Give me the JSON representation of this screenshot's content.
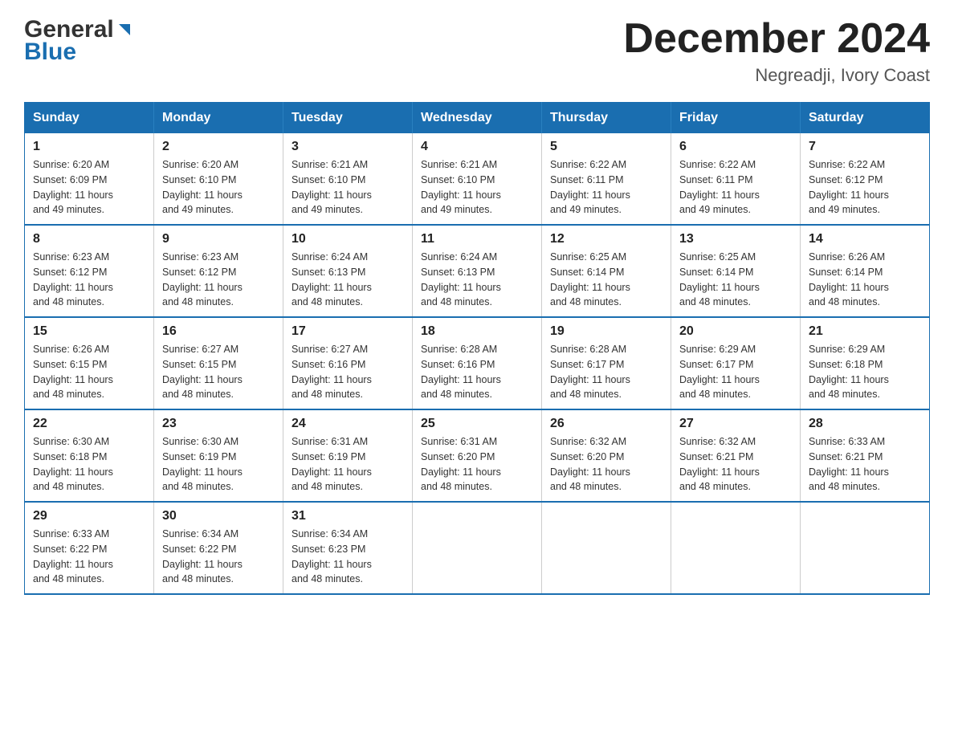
{
  "header": {
    "logo_general": "General",
    "logo_blue": "Blue",
    "month_title": "December 2024",
    "location": "Negreadji, Ivory Coast"
  },
  "days_of_week": [
    "Sunday",
    "Monday",
    "Tuesday",
    "Wednesday",
    "Thursday",
    "Friday",
    "Saturday"
  ],
  "weeks": [
    [
      {
        "day": "1",
        "sunrise": "6:20 AM",
        "sunset": "6:09 PM",
        "daylight": "11 hours and 49 minutes."
      },
      {
        "day": "2",
        "sunrise": "6:20 AM",
        "sunset": "6:10 PM",
        "daylight": "11 hours and 49 minutes."
      },
      {
        "day": "3",
        "sunrise": "6:21 AM",
        "sunset": "6:10 PM",
        "daylight": "11 hours and 49 minutes."
      },
      {
        "day": "4",
        "sunrise": "6:21 AM",
        "sunset": "6:10 PM",
        "daylight": "11 hours and 49 minutes."
      },
      {
        "day": "5",
        "sunrise": "6:22 AM",
        "sunset": "6:11 PM",
        "daylight": "11 hours and 49 minutes."
      },
      {
        "day": "6",
        "sunrise": "6:22 AM",
        "sunset": "6:11 PM",
        "daylight": "11 hours and 49 minutes."
      },
      {
        "day": "7",
        "sunrise": "6:22 AM",
        "sunset": "6:12 PM",
        "daylight": "11 hours and 49 minutes."
      }
    ],
    [
      {
        "day": "8",
        "sunrise": "6:23 AM",
        "sunset": "6:12 PM",
        "daylight": "11 hours and 48 minutes."
      },
      {
        "day": "9",
        "sunrise": "6:23 AM",
        "sunset": "6:12 PM",
        "daylight": "11 hours and 48 minutes."
      },
      {
        "day": "10",
        "sunrise": "6:24 AM",
        "sunset": "6:13 PM",
        "daylight": "11 hours and 48 minutes."
      },
      {
        "day": "11",
        "sunrise": "6:24 AM",
        "sunset": "6:13 PM",
        "daylight": "11 hours and 48 minutes."
      },
      {
        "day": "12",
        "sunrise": "6:25 AM",
        "sunset": "6:14 PM",
        "daylight": "11 hours and 48 minutes."
      },
      {
        "day": "13",
        "sunrise": "6:25 AM",
        "sunset": "6:14 PM",
        "daylight": "11 hours and 48 minutes."
      },
      {
        "day": "14",
        "sunrise": "6:26 AM",
        "sunset": "6:14 PM",
        "daylight": "11 hours and 48 minutes."
      }
    ],
    [
      {
        "day": "15",
        "sunrise": "6:26 AM",
        "sunset": "6:15 PM",
        "daylight": "11 hours and 48 minutes."
      },
      {
        "day": "16",
        "sunrise": "6:27 AM",
        "sunset": "6:15 PM",
        "daylight": "11 hours and 48 minutes."
      },
      {
        "day": "17",
        "sunrise": "6:27 AM",
        "sunset": "6:16 PM",
        "daylight": "11 hours and 48 minutes."
      },
      {
        "day": "18",
        "sunrise": "6:28 AM",
        "sunset": "6:16 PM",
        "daylight": "11 hours and 48 minutes."
      },
      {
        "day": "19",
        "sunrise": "6:28 AM",
        "sunset": "6:17 PM",
        "daylight": "11 hours and 48 minutes."
      },
      {
        "day": "20",
        "sunrise": "6:29 AM",
        "sunset": "6:17 PM",
        "daylight": "11 hours and 48 minutes."
      },
      {
        "day": "21",
        "sunrise": "6:29 AM",
        "sunset": "6:18 PM",
        "daylight": "11 hours and 48 minutes."
      }
    ],
    [
      {
        "day": "22",
        "sunrise": "6:30 AM",
        "sunset": "6:18 PM",
        "daylight": "11 hours and 48 minutes."
      },
      {
        "day": "23",
        "sunrise": "6:30 AM",
        "sunset": "6:19 PM",
        "daylight": "11 hours and 48 minutes."
      },
      {
        "day": "24",
        "sunrise": "6:31 AM",
        "sunset": "6:19 PM",
        "daylight": "11 hours and 48 minutes."
      },
      {
        "day": "25",
        "sunrise": "6:31 AM",
        "sunset": "6:20 PM",
        "daylight": "11 hours and 48 minutes."
      },
      {
        "day": "26",
        "sunrise": "6:32 AM",
        "sunset": "6:20 PM",
        "daylight": "11 hours and 48 minutes."
      },
      {
        "day": "27",
        "sunrise": "6:32 AM",
        "sunset": "6:21 PM",
        "daylight": "11 hours and 48 minutes."
      },
      {
        "day": "28",
        "sunrise": "6:33 AM",
        "sunset": "6:21 PM",
        "daylight": "11 hours and 48 minutes."
      }
    ],
    [
      {
        "day": "29",
        "sunrise": "6:33 AM",
        "sunset": "6:22 PM",
        "daylight": "11 hours and 48 minutes."
      },
      {
        "day": "30",
        "sunrise": "6:34 AM",
        "sunset": "6:22 PM",
        "daylight": "11 hours and 48 minutes."
      },
      {
        "day": "31",
        "sunrise": "6:34 AM",
        "sunset": "6:23 PM",
        "daylight": "11 hours and 48 minutes."
      },
      null,
      null,
      null,
      null
    ]
  ]
}
